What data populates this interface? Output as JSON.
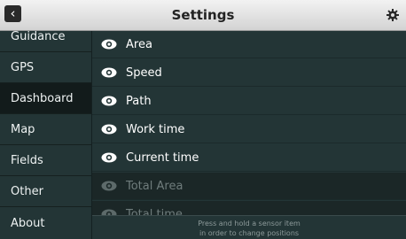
{
  "header": {
    "back_glyph": "‹",
    "title": "Settings",
    "back_icon": "chevron-left-icon",
    "settings_icon": "gear-icon"
  },
  "sidebar": {
    "items": [
      {
        "label": "Guidance",
        "active": false
      },
      {
        "label": "GPS",
        "active": false
      },
      {
        "label": "Dashboard",
        "active": true
      },
      {
        "label": "Map",
        "active": false
      },
      {
        "label": "Fields",
        "active": false
      },
      {
        "label": "Other",
        "active": false
      },
      {
        "label": "About",
        "active": false
      }
    ]
  },
  "main": {
    "sensors": [
      {
        "label": "Area",
        "visible": true
      },
      {
        "label": "Speed",
        "visible": true
      },
      {
        "label": "Path",
        "visible": true
      },
      {
        "label": "Work time",
        "visible": true
      },
      {
        "label": "Current time",
        "visible": true
      },
      {
        "label": "Total Area",
        "visible": false
      },
      {
        "label": "Total time",
        "visible": false
      }
    ],
    "hint_line1": "Press and hold a sensor item",
    "hint_line2": "in order to change positions"
  },
  "colors": {
    "background": "#233536",
    "active_item": "#121b1b",
    "header": "#e6e6e6",
    "hidden_text": "#6f7c7c"
  }
}
